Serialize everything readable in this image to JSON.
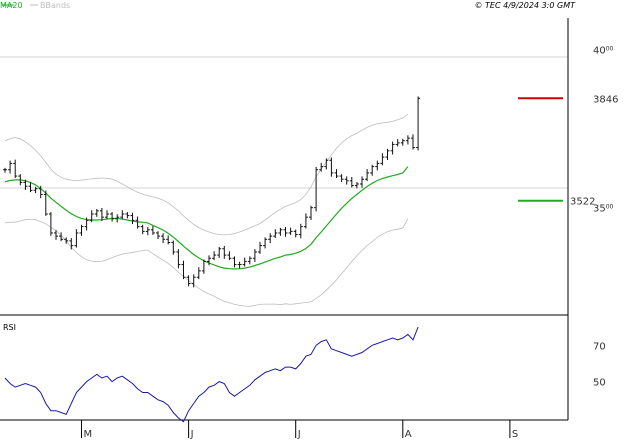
{
  "legend": {
    "ma_label": "MA20",
    "bb_label": "BBands"
  },
  "header": {
    "copyright": "© TEC 4/9/2024 3:0 GMT"
  },
  "colors": {
    "price_bars": "#111111",
    "ma20": "#22aa22",
    "bbands": "#bdbdbd",
    "rsi": "#1a1aa6",
    "resistance": "#cc0000",
    "support": "#22aa22",
    "grid": "#d6d6d6",
    "frame": "#000000"
  },
  "chart_data": [
    {
      "type": "line",
      "panel": "price",
      "ylim": [
        3170,
        4100
      ],
      "yticks": [
        {
          "value": 4000,
          "label": "4000"
        },
        {
          "value": 3500,
          "label": "3500"
        }
      ],
      "grid": true,
      "xticks": [
        "M",
        "J",
        "J",
        "A",
        "S"
      ],
      "xtick_index": [
        15,
        36,
        57,
        78,
        99
      ],
      "series": [
        {
          "name": "MA20",
          "values": [
            3582,
            3586,
            3588,
            3588,
            3585,
            3580,
            3572,
            3560,
            3546,
            3530,
            3517,
            3504,
            3492,
            3481,
            3472,
            3466,
            3462,
            3461,
            3461,
            3462,
            3464,
            3466,
            3466,
            3464,
            3461,
            3458,
            3455,
            3454,
            3452,
            3444,
            3437,
            3429,
            3419,
            3407,
            3393,
            3378,
            3365,
            3352,
            3341,
            3332,
            3325,
            3319,
            3313,
            3309,
            3307,
            3306,
            3307,
            3309,
            3312,
            3317,
            3322,
            3328,
            3334,
            3340,
            3344,
            3350,
            3352,
            3356,
            3362,
            3371,
            3384,
            3405,
            3423,
            3442,
            3461,
            3480,
            3498,
            3514,
            3529,
            3542,
            3555,
            3567,
            3577,
            3586,
            3592,
            3597,
            3601,
            3605,
            3610,
            3630
          ]
        },
        {
          "name": "BBands",
          "values": [
            3712,
            3718,
            3722,
            3718,
            3708,
            3696,
            3682,
            3664,
            3643,
            3622,
            3606,
            3596,
            3590,
            3587,
            3586,
            3587,
            3589,
            3591,
            3593,
            3594,
            3593,
            3590,
            3584,
            3575,
            3566,
            3557,
            3549,
            3543,
            3538,
            3534,
            3530,
            3524,
            3515,
            3503,
            3490,
            3474,
            3460,
            3447,
            3437,
            3429,
            3423,
            3418,
            3415,
            3414,
            3415,
            3418,
            3423,
            3429,
            3436,
            3443,
            3450,
            3461,
            3473,
            3485,
            3495,
            3504,
            3510,
            3516,
            3526,
            3542,
            3566,
            3597,
            3622,
            3645,
            3667,
            3688,
            3705,
            3718,
            3728,
            3736,
            3745,
            3754,
            3761,
            3766,
            3768,
            3770,
            3773,
            3778,
            3784,
            3795
          ]
        },
        {
          "name": "BBands",
          "values": [
            3452,
            3454,
            3454,
            3458,
            3462,
            3464,
            3462,
            3456,
            3449,
            3438,
            3428,
            3412,
            3394,
            3375,
            3358,
            3345,
            3335,
            3331,
            3329,
            3330,
            3335,
            3342,
            3348,
            3353,
            3356,
            3359,
            3361,
            3365,
            3366,
            3354,
            3344,
            3334,
            3323,
            3311,
            3296,
            3282,
            3270,
            3257,
            3245,
            3235,
            3227,
            3220,
            3211,
            3204,
            3199,
            3194,
            3191,
            3189,
            3188,
            3191,
            3194,
            3195,
            3195,
            3195,
            3193,
            3196,
            3194,
            3196,
            3198,
            3200,
            3202,
            3213,
            3224,
            3239,
            3255,
            3272,
            3291,
            3310,
            3330,
            3348,
            3365,
            3380,
            3393,
            3406,
            3416,
            3424,
            3429,
            3432,
            3436,
            3465
          ]
        }
      ],
      "closes": [
        3620,
        3640,
        3600,
        3580,
        3568,
        3555,
        3560,
        3542,
        3480,
        3420,
        3410,
        3400,
        3395,
        3380,
        3420,
        3440,
        3460,
        3480,
        3490,
        3470,
        3480,
        3465,
        3470,
        3480,
        3475,
        3460,
        3440,
        3425,
        3430,
        3420,
        3410,
        3400,
        3390,
        3360,
        3320,
        3280,
        3260,
        3280,
        3300,
        3330,
        3340,
        3350,
        3370,
        3350,
        3340,
        3320,
        3320,
        3330,
        3340,
        3360,
        3380,
        3400,
        3410,
        3420,
        3430,
        3420,
        3425,
        3415,
        3440,
        3470,
        3500,
        3620,
        3630,
        3650,
        3610,
        3600,
        3590,
        3585,
        3570,
        3575,
        3590,
        3610,
        3630,
        3640,
        3660,
        3680,
        3700,
        3705,
        3712,
        3720,
        3690,
        3846
      ],
      "resistance": {
        "value": 3846,
        "label": "3846"
      },
      "support": {
        "value": 3522,
        "label": "3522"
      }
    },
    {
      "type": "line",
      "panel": "rsi",
      "title": "RSI",
      "ylim": [
        30,
        85
      ],
      "yticks": [
        {
          "value": 70,
          "label": "70"
        },
        {
          "value": 50,
          "label": "50"
        }
      ],
      "series": [
        {
          "name": "RSI",
          "values": [
            52,
            49,
            47,
            48,
            49,
            48,
            47,
            44,
            38,
            34,
            34,
            33,
            32,
            38,
            44,
            47,
            50,
            52,
            54,
            52,
            53,
            50,
            52,
            53,
            51,
            49,
            46,
            44,
            44,
            42,
            40,
            39,
            37,
            33,
            30,
            28,
            34,
            38,
            42,
            44,
            47,
            48,
            50,
            49,
            44,
            42,
            44,
            46,
            48,
            51,
            53,
            55,
            56,
            57,
            56,
            58,
            58,
            57,
            60,
            64,
            65,
            70,
            72,
            73,
            68,
            67,
            66,
            65,
            64,
            65,
            66,
            68,
            70,
            71,
            72,
            73,
            74,
            73,
            74,
            76,
            73,
            80
          ]
        }
      ]
    }
  ]
}
